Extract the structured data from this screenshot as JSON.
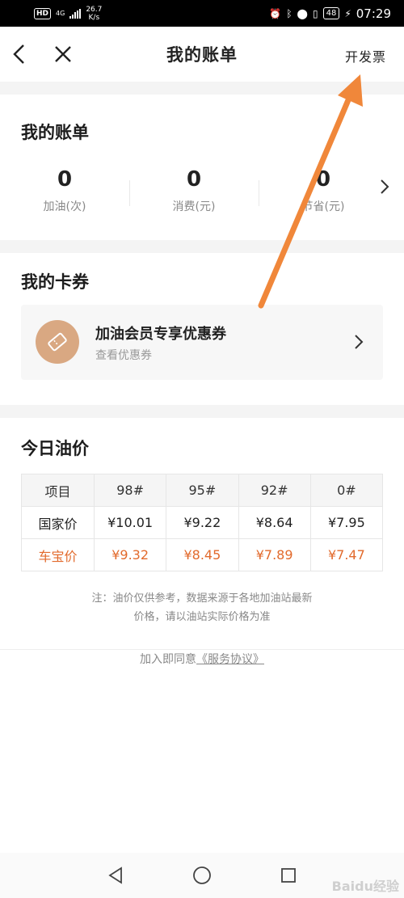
{
  "status_bar": {
    "hd": "HD",
    "net_type": "4G",
    "speed_value": "26.7",
    "speed_unit": "K/s",
    "battery": "48",
    "time": "07:29"
  },
  "nav": {
    "title": "我的账单",
    "invoice_label": "开发票",
    "back_icon": "chevron-left-icon",
    "close_icon": "close-icon"
  },
  "bill": {
    "title": "我的账单",
    "stats": [
      {
        "value": "0",
        "label": "加油(次)"
      },
      {
        "value": "0",
        "label": "消费(元)"
      },
      {
        "value": "0",
        "label": "节省(元)"
      }
    ]
  },
  "cards": {
    "title": "我的卡券",
    "coupon": {
      "title": "加油会员专享优惠券",
      "subtitle": "查看优惠券",
      "icon": "ticket-icon",
      "color": "#d9a882"
    }
  },
  "price": {
    "title": "今日油价",
    "headers": [
      "项目",
      "98#",
      "95#",
      "92#",
      "0#"
    ],
    "rows": [
      {
        "label": "国家价",
        "values": [
          "¥10.01",
          "¥9.22",
          "¥8.64",
          "¥7.95"
        ]
      },
      {
        "label": "车宝价",
        "values": [
          "¥9.32",
          "¥8.45",
          "¥7.89",
          "¥7.47"
        ]
      }
    ],
    "highlight_color": "#e26a2c",
    "note_line1": "注：油价仅供参考，数据来源于各地加油站最新",
    "note_line2": "价格，请以油站实际价格为准"
  },
  "agreement": {
    "prefix": "加入即同意",
    "link": "《服务协议》"
  },
  "bottom_nav": {
    "back": "triangle-back-icon",
    "home": "circle-home-icon",
    "recents": "square-recents-icon"
  },
  "watermark": "Baidu经验",
  "annotation_arrow_color": "#f0873a"
}
